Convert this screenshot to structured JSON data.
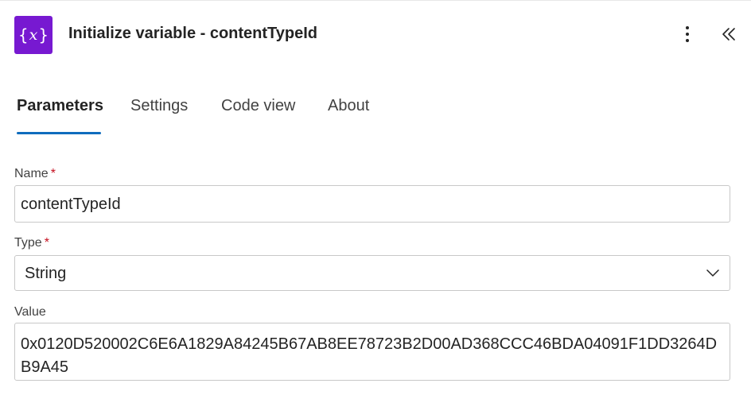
{
  "header": {
    "title": "Initialize variable - contentTypeId",
    "icon": "variable-icon",
    "icon_color": "#7719d1"
  },
  "tabs": [
    {
      "label": "Parameters",
      "active": true
    },
    {
      "label": "Settings",
      "active": false
    },
    {
      "label": "Code view",
      "active": false
    },
    {
      "label": "About",
      "active": false
    }
  ],
  "accent_color": "#0f6cbd",
  "fields": {
    "name": {
      "label": "Name",
      "required_mark": "*",
      "value": "contentTypeId"
    },
    "type": {
      "label": "Type",
      "required_mark": "*",
      "value": "String"
    },
    "value": {
      "label": "Value",
      "value": "0x0120D520002C6E6A1829A84245B67AB8EE78723B2D00AD368CCC46BDA04091F1DD3264DB9A45"
    }
  }
}
